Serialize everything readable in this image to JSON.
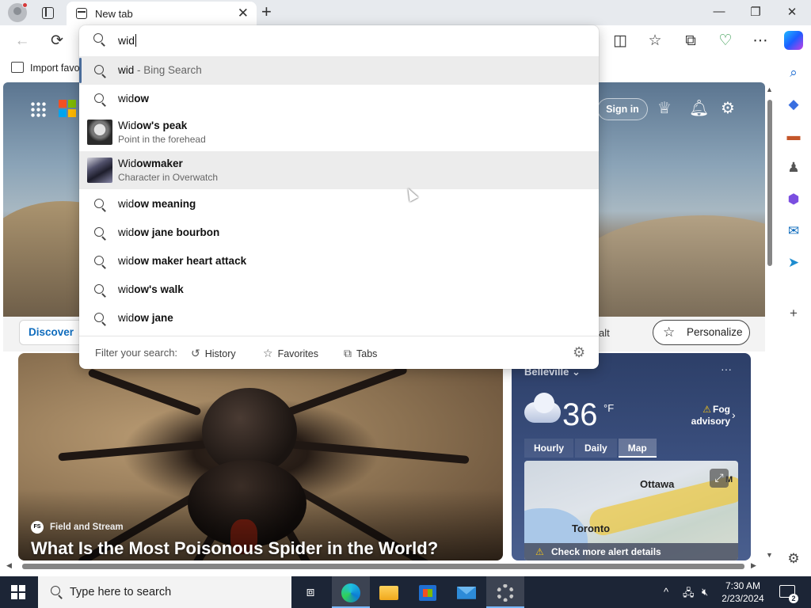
{
  "browser": {
    "tab_title": "New tab",
    "tab_close": "✕",
    "new_tab": "+",
    "window_controls": {
      "minimize": "—",
      "restore": "❐",
      "close": "✕"
    }
  },
  "toolbar": {
    "back": "←",
    "refresh": "⟳",
    "split": "◫",
    "favorites": "☆",
    "collections": "⧉",
    "performance": "♡",
    "more": "⋯"
  },
  "favorites_bar": {
    "import_label": "Import favo"
  },
  "omnibox": {
    "typed": "wid",
    "suggestions": [
      {
        "typed": "wid",
        "rest": "",
        "muted": " - Bing Search"
      },
      {
        "typed": "wid",
        "rest": "ow"
      },
      {
        "typed": "Wid",
        "rest": "ow's peak",
        "subtitle": "Point in the forehead"
      },
      {
        "typed": "Wid",
        "rest": "owmaker",
        "subtitle": "Character in Overwatch"
      },
      {
        "typed": "wid",
        "rest": "ow meaning"
      },
      {
        "typed": "wid",
        "rest": "ow jane bourbon"
      },
      {
        "typed": "wid",
        "rest": "ow maker heart attack"
      },
      {
        "typed": "wid",
        "rest": "ow's walk"
      },
      {
        "typed": "wid",
        "rest": "ow jane"
      }
    ],
    "filter": {
      "label": "Filter your search:",
      "history": "History",
      "favorites": "Favorites",
      "tabs": "Tabs"
    }
  },
  "newtab": {
    "signin": "Sign in",
    "discover": "Discover",
    "feed_tail": "alt",
    "personalize": "Personalize",
    "article": {
      "source_badge": "FS",
      "source": "Field and Stream",
      "title": "What Is the Most Poisonous Spider in the World?"
    },
    "weather": {
      "location": "Belleville",
      "more": "···",
      "temperature": "36",
      "unit": "°F",
      "alert_line1": "Fog",
      "alert_line2": "advisory",
      "tabs": [
        "Hourly",
        "Daily",
        "Map"
      ],
      "active_tab": "Map",
      "map_labels": {
        "city1": "Ottawa",
        "city2": "Toronto",
        "city3": "M"
      },
      "map_alert": "Check more alert details"
    }
  },
  "taskbar": {
    "search_placeholder": "Type here to search",
    "time": "7:30 AM",
    "date": "2/23/2024",
    "notification_count": "2"
  },
  "colors": {
    "taskbar": "#1c2536",
    "accent": "#0f6cbd",
    "highlight_row": "#ececec"
  }
}
